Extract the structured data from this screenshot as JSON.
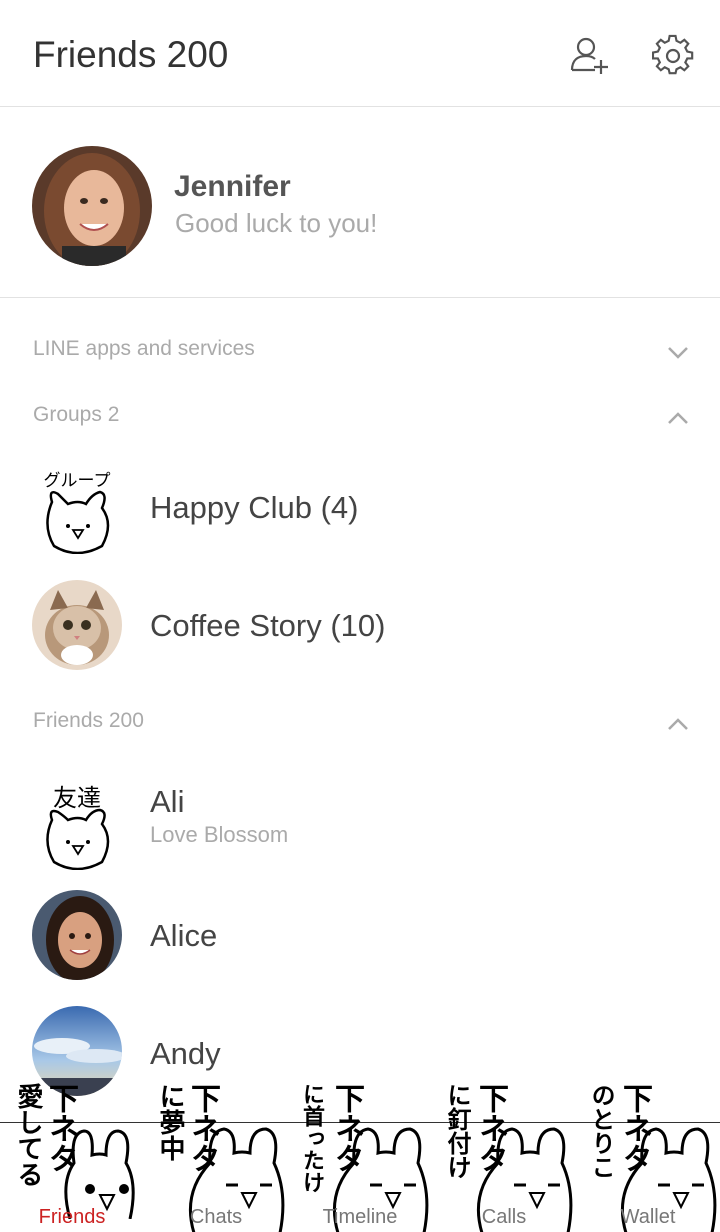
{
  "header": {
    "title": "Friends 200",
    "add_friend_icon": "add-friend-icon",
    "settings_icon": "gear-icon"
  },
  "profile": {
    "name": "Jennifer",
    "status": "Good luck to you!"
  },
  "sections": {
    "apps": {
      "label": "LINE apps and services",
      "state": "collapsed"
    },
    "groups": {
      "label": "Groups 2",
      "state": "expanded"
    },
    "friends": {
      "label": "Friends 200",
      "state": "expanded"
    }
  },
  "groups": [
    {
      "name": "Happy Club (4)",
      "sticker_text": "グループ"
    },
    {
      "name": "Coffee Story (10)"
    }
  ],
  "friends": [
    {
      "name": "Ali",
      "status": "Love Blossom",
      "sticker_text": "友達"
    },
    {
      "name": "Alice",
      "status": ""
    },
    {
      "name": "Andy",
      "status": ""
    }
  ],
  "tabs": [
    {
      "label": "Friends",
      "sticker_text": "愛してる",
      "head": "下ネタ",
      "active": true
    },
    {
      "label": "Chats",
      "sticker_text": "に夢中",
      "head": "下ネタ",
      "active": false
    },
    {
      "label": "Timeline",
      "sticker_text": "に首ったけ",
      "head": "下ネタ",
      "active": false
    },
    {
      "label": "Calls",
      "sticker_text": "に釘付け",
      "head": "下ネタ",
      "active": false
    },
    {
      "label": "Wallet",
      "sticker_text": "のとりこ",
      "head": "下ネタ",
      "active": false
    }
  ],
  "colors": {
    "active_tab": "#cc2222",
    "muted_text": "#aaaaaa",
    "divider": "#e2e2e2"
  }
}
